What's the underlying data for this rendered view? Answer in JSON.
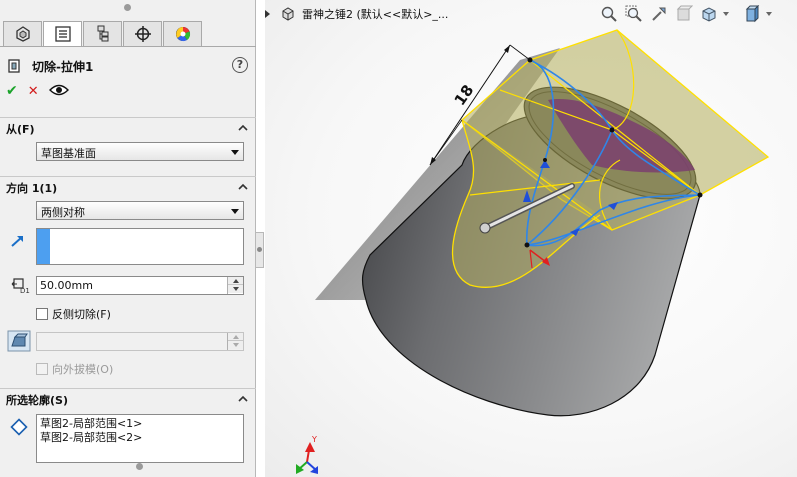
{
  "feature": {
    "title": "切除-拉伸1"
  },
  "tabs": [
    {
      "icon": "feature-manager-icon"
    },
    {
      "icon": "property-manager-icon"
    },
    {
      "icon": "configuration-manager-icon"
    },
    {
      "icon": "dimxpert-icon"
    },
    {
      "icon": "display-manager-icon"
    }
  ],
  "actions": {
    "ok": "✔",
    "cancel": "✕",
    "preview": "👁"
  },
  "help": "?",
  "from_section": {
    "label": "从(F)",
    "start_condition": "草图基准面"
  },
  "direction1": {
    "label": "方向 1(1)",
    "end_condition": "两侧对称",
    "depth": "50.00mm",
    "flip_side": "反侧切除(F)",
    "draft_value": "",
    "draft_outward": "向外拔模(O)"
  },
  "contours": {
    "label": "所选轮廓(S)",
    "items": [
      "草图2-局部范围<1>",
      "草图2-局部范围<2>"
    ]
  },
  "viewport": {
    "tree_text": "雷神之锤2  (默认<<默认>_...",
    "dimension": "18",
    "colors": {
      "body": "#6e6f71",
      "preview_fill": "#b3ad5a",
      "sketch": "#ffe000",
      "profile": "#2f86e8",
      "cut_region": "#7a3f6e",
      "axis_x": "#e02020",
      "axis_y": "#22aa22",
      "axis_z": "#2244dd"
    }
  },
  "triad": {
    "y_label": "Y"
  }
}
